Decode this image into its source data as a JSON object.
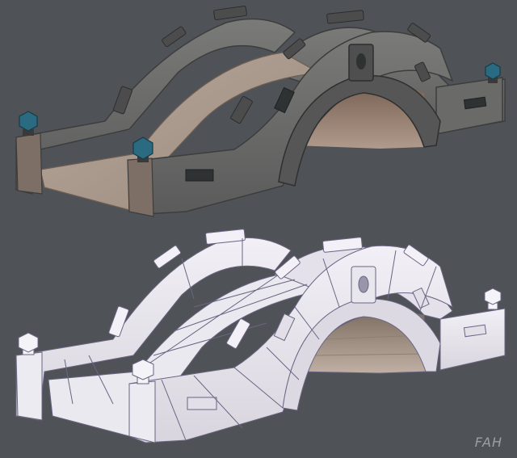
{
  "scene": {
    "background": "#4f5358",
    "textured_bridge": {
      "stone": "#6e6f6d",
      "stone_dark": "#4b4c4b",
      "deck": "#a8978a",
      "underside": "#8b7567",
      "finial": "#2b6b82",
      "inlay": "#2f3232"
    },
    "wireframe_bridge": {
      "face": "#e9e7ee",
      "face_shade": "#d3d0da",
      "edge": "#6b6582",
      "underside": "#9a8a7d"
    }
  },
  "watermark": "FAH"
}
